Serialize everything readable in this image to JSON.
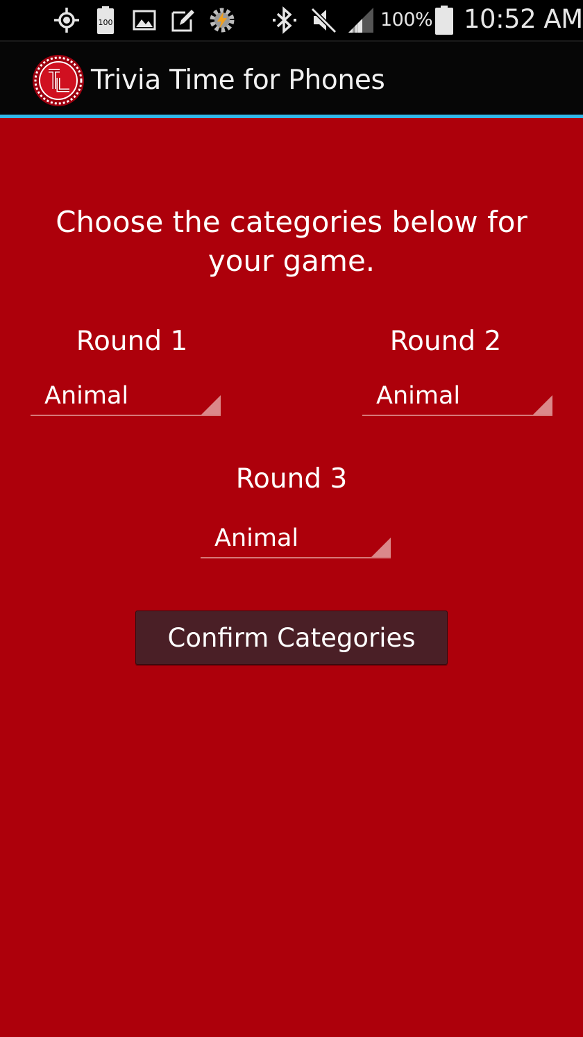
{
  "status_bar": {
    "icons": [
      "gps-icon",
      "battery-100-notification-icon",
      "image-notification-icon",
      "edit-notification-icon",
      "tasker-icon",
      "bluetooth-icon",
      "mute-icon",
      "signal-icon",
      "battery-icon"
    ],
    "battery_notification_text": "100",
    "battery_percent": "100%",
    "time": "10:52 AM"
  },
  "app_bar": {
    "title": "Trivia Time for Phones",
    "logo_icon": "trivia-time-logo-icon"
  },
  "main": {
    "instructions": "Choose the categories below for your game.",
    "rounds": [
      {
        "label": "Round 1",
        "selected": "Animal"
      },
      {
        "label": "Round 2",
        "selected": "Animal"
      },
      {
        "label": "Round 3",
        "selected": "Animal"
      }
    ],
    "confirm_label": "Confirm Categories"
  },
  "colors": {
    "background": "#ad000b",
    "action_bar": "#060606",
    "action_bar_accent": "#31b6e7",
    "button": "#4a1f26"
  }
}
